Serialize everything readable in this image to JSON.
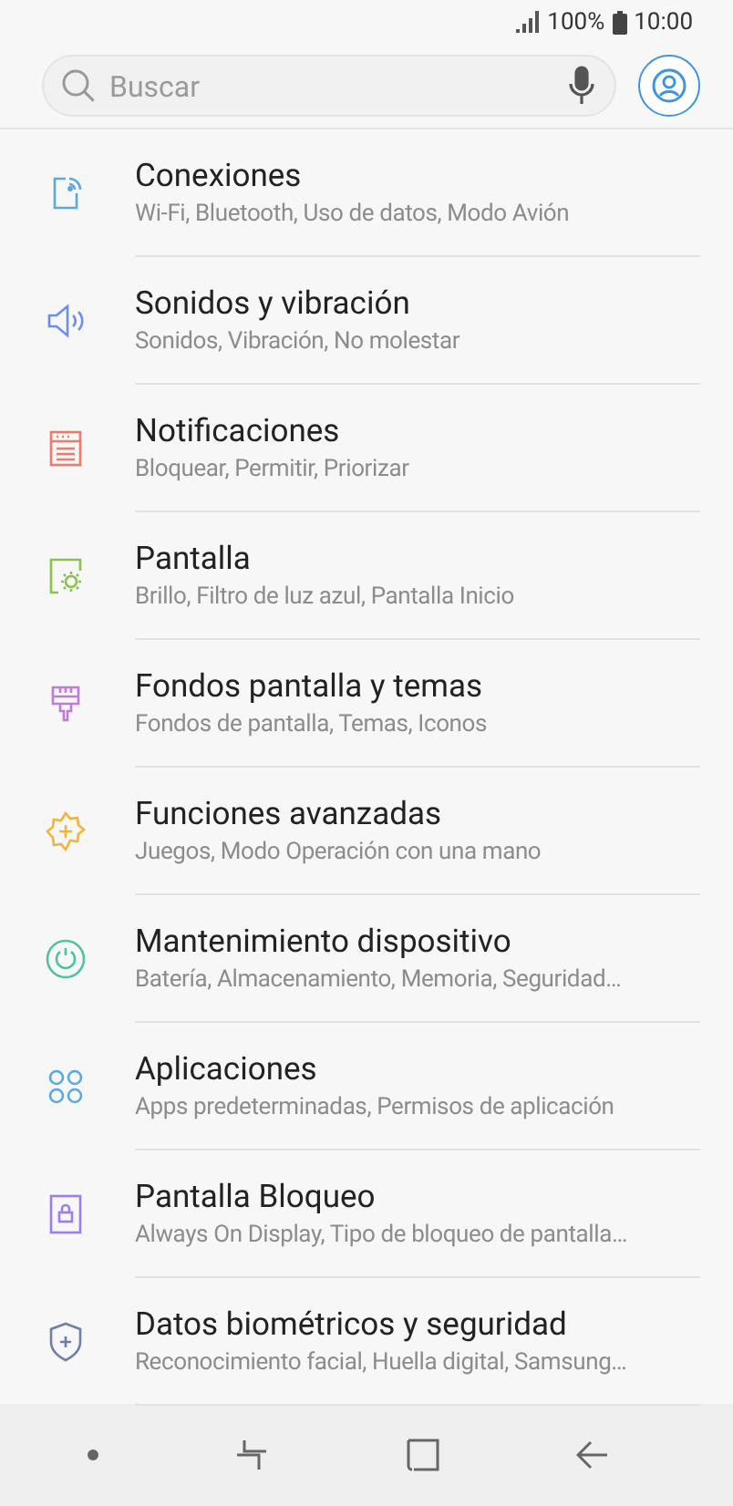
{
  "status_bar": {
    "battery_text": "100%",
    "time": "10:00"
  },
  "search": {
    "placeholder": "Buscar"
  },
  "items": [
    {
      "title": "Conexiones",
      "subtitle": "Wi-Fi, Bluetooth, Uso de datos, Modo Avión"
    },
    {
      "title": "Sonidos y vibración",
      "subtitle": "Sonidos, Vibración, No molestar"
    },
    {
      "title": "Notificaciones",
      "subtitle": "Bloquear, Permitir, Priorizar"
    },
    {
      "title": "Pantalla",
      "subtitle": "Brillo, Filtro de luz azul, Pantalla Inicio"
    },
    {
      "title": "Fondos pantalla y temas",
      "subtitle": "Fondos de pantalla, Temas, Iconos"
    },
    {
      "title": "Funciones avanzadas",
      "subtitle": "Juegos, Modo Operación con una mano"
    },
    {
      "title": "Mantenimiento dispositivo",
      "subtitle": "Batería, Almacenamiento, Memoria, Seguridad…"
    },
    {
      "title": "Aplicaciones",
      "subtitle": "Apps predeterminadas, Permisos de aplicación"
    },
    {
      "title": "Pantalla Bloqueo",
      "subtitle": "Always On Display, Tipo de bloqueo de pantalla…"
    },
    {
      "title": "Datos biométricos y seguridad",
      "subtitle": "Reconocimiento facial, Huella digital, Samsung…"
    }
  ]
}
